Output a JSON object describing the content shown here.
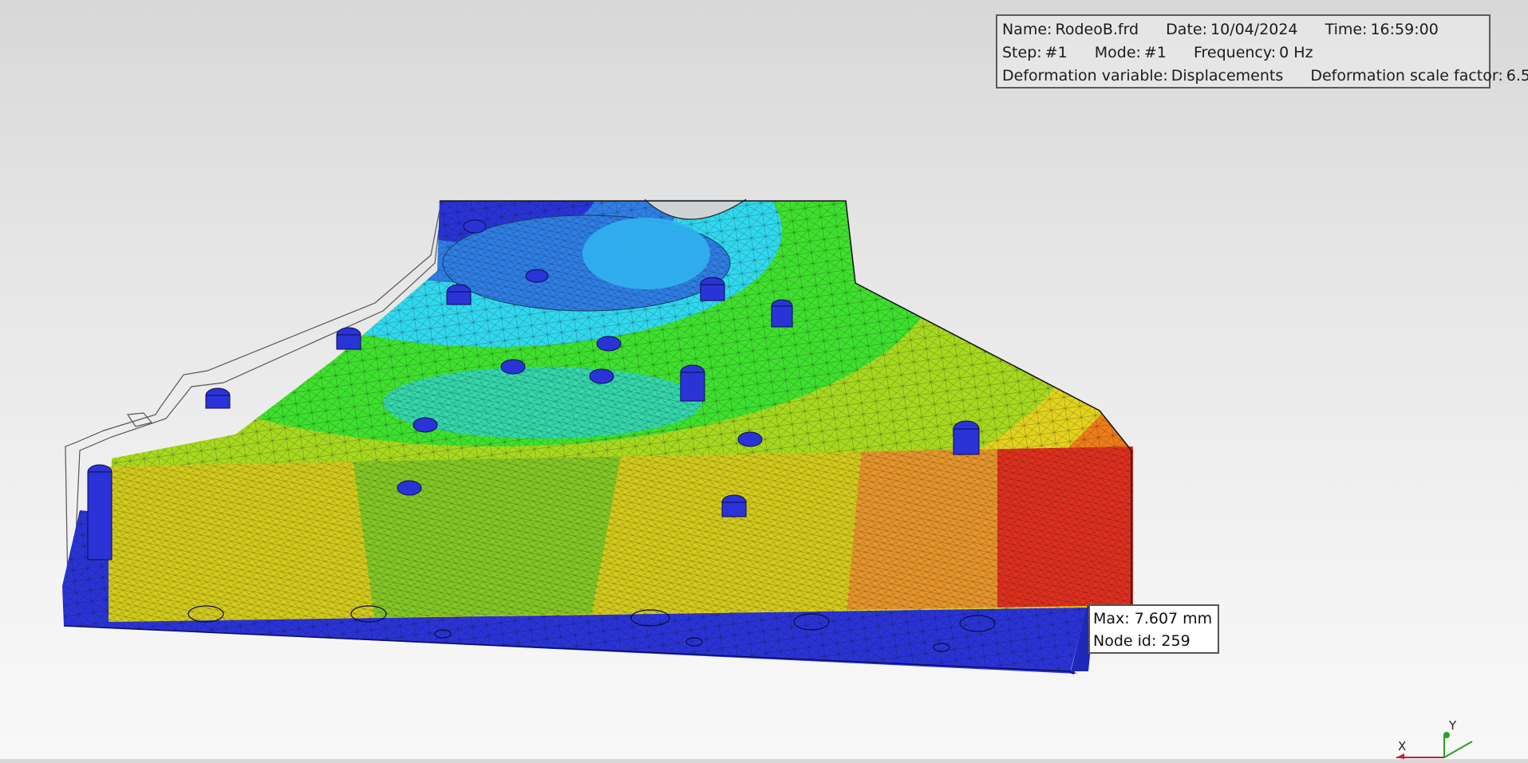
{
  "info": {
    "name_label": "Name:",
    "name_value": "RodeoB.frd",
    "date_label": "Date:",
    "date_value": "10/04/2024",
    "time_label": "Time:",
    "time_value": "16:59:00",
    "step_label": "Step:",
    "step_value": "#1",
    "mode_label": "Mode:",
    "mode_value": "#1",
    "frequency_label": "Frequency:",
    "frequency_value": "0 Hz",
    "deformation_variable_label": "Deformation variable:",
    "deformation_variable_value": "Displacements",
    "scale_factor_label": "Deformation scale factor:",
    "scale_factor_value": "6.5"
  },
  "max_annotation": {
    "max_label": "Max:",
    "max_value": "7.607 mm",
    "node_label": "Node id:",
    "node_value": "259"
  },
  "axes": {
    "x_label": "X",
    "y_label": "Y"
  },
  "colors": {
    "min_blue": "#2a34d6",
    "light_blue": "#2f7fe6",
    "cyan": "#31d9ef",
    "green": "#3fe12e",
    "yellow_green": "#a8d91f",
    "yellow": "#e3d31d",
    "orange": "#ee7d1a",
    "red": "#ed2b20"
  }
}
